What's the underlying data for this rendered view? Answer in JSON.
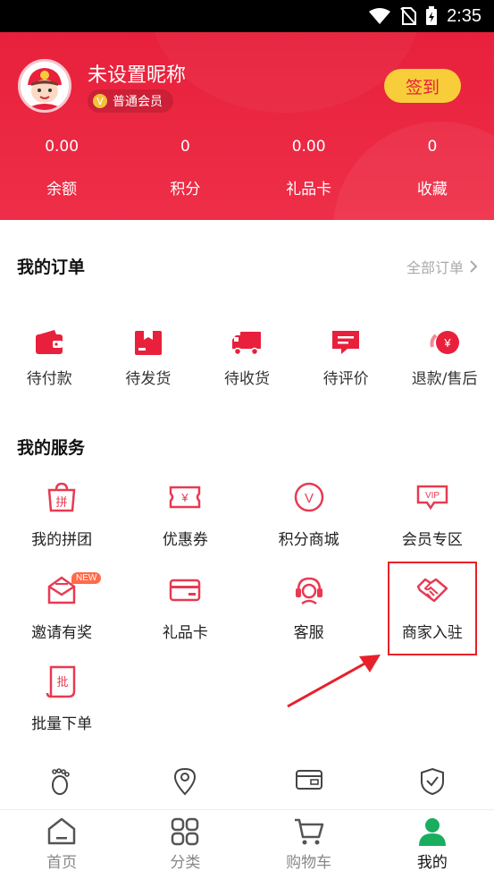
{
  "status_bar": {
    "time": "2:35"
  },
  "profile": {
    "nickname": "未设置昵称",
    "member_level": "普通会员",
    "member_badge_letter": "V",
    "signin_label": "签到"
  },
  "stats": [
    {
      "value": "0.00",
      "label": "余额"
    },
    {
      "value": "0",
      "label": "积分"
    },
    {
      "value": "0.00",
      "label": "礼品卡"
    },
    {
      "value": "0",
      "label": "收藏"
    }
  ],
  "orders": {
    "title": "我的订单",
    "all_orders_label": "全部订单",
    "items": [
      {
        "label": "待付款",
        "icon": "wallet-icon"
      },
      {
        "label": "待发货",
        "icon": "package-icon"
      },
      {
        "label": "待收货",
        "icon": "truck-icon"
      },
      {
        "label": "待评价",
        "icon": "comment-icon"
      },
      {
        "label": "退款/售后",
        "icon": "refund-icon"
      }
    ]
  },
  "services": {
    "title": "我的服务",
    "items": [
      {
        "label": "我的拼团",
        "icon": "group-buy-icon",
        "glyph": "拼"
      },
      {
        "label": "优惠券",
        "icon": "coupon-icon",
        "glyph": "¥"
      },
      {
        "label": "积分商城",
        "icon": "points-mall-icon",
        "glyph": "V"
      },
      {
        "label": "会员专区",
        "icon": "vip-icon",
        "glyph": "VIP"
      },
      {
        "label": "邀请有奖",
        "icon": "invite-icon",
        "badge": "NEW"
      },
      {
        "label": "礼品卡",
        "icon": "gift-card-icon"
      },
      {
        "label": "客服",
        "icon": "customer-service-icon"
      },
      {
        "label": "商家入驻",
        "icon": "handshake-icon"
      },
      {
        "label": "批量下单",
        "icon": "bulk-order-icon",
        "glyph": "批"
      }
    ]
  },
  "extra_icons": [
    "footprint-icon",
    "location-icon",
    "wallet-card-icon",
    "shield-check-icon"
  ],
  "bottom_nav": [
    {
      "label": "首页",
      "icon": "home-icon",
      "active": false
    },
    {
      "label": "分类",
      "icon": "category-icon",
      "active": false
    },
    {
      "label": "购物车",
      "icon": "cart-icon",
      "active": false
    },
    {
      "label": "我的",
      "icon": "user-icon",
      "active": true
    }
  ],
  "colors": {
    "brand_red": "#e8203b",
    "signin_yellow": "#f7cd3a",
    "icon_pink": "#e83a52",
    "active_green": "#1aad5e"
  }
}
